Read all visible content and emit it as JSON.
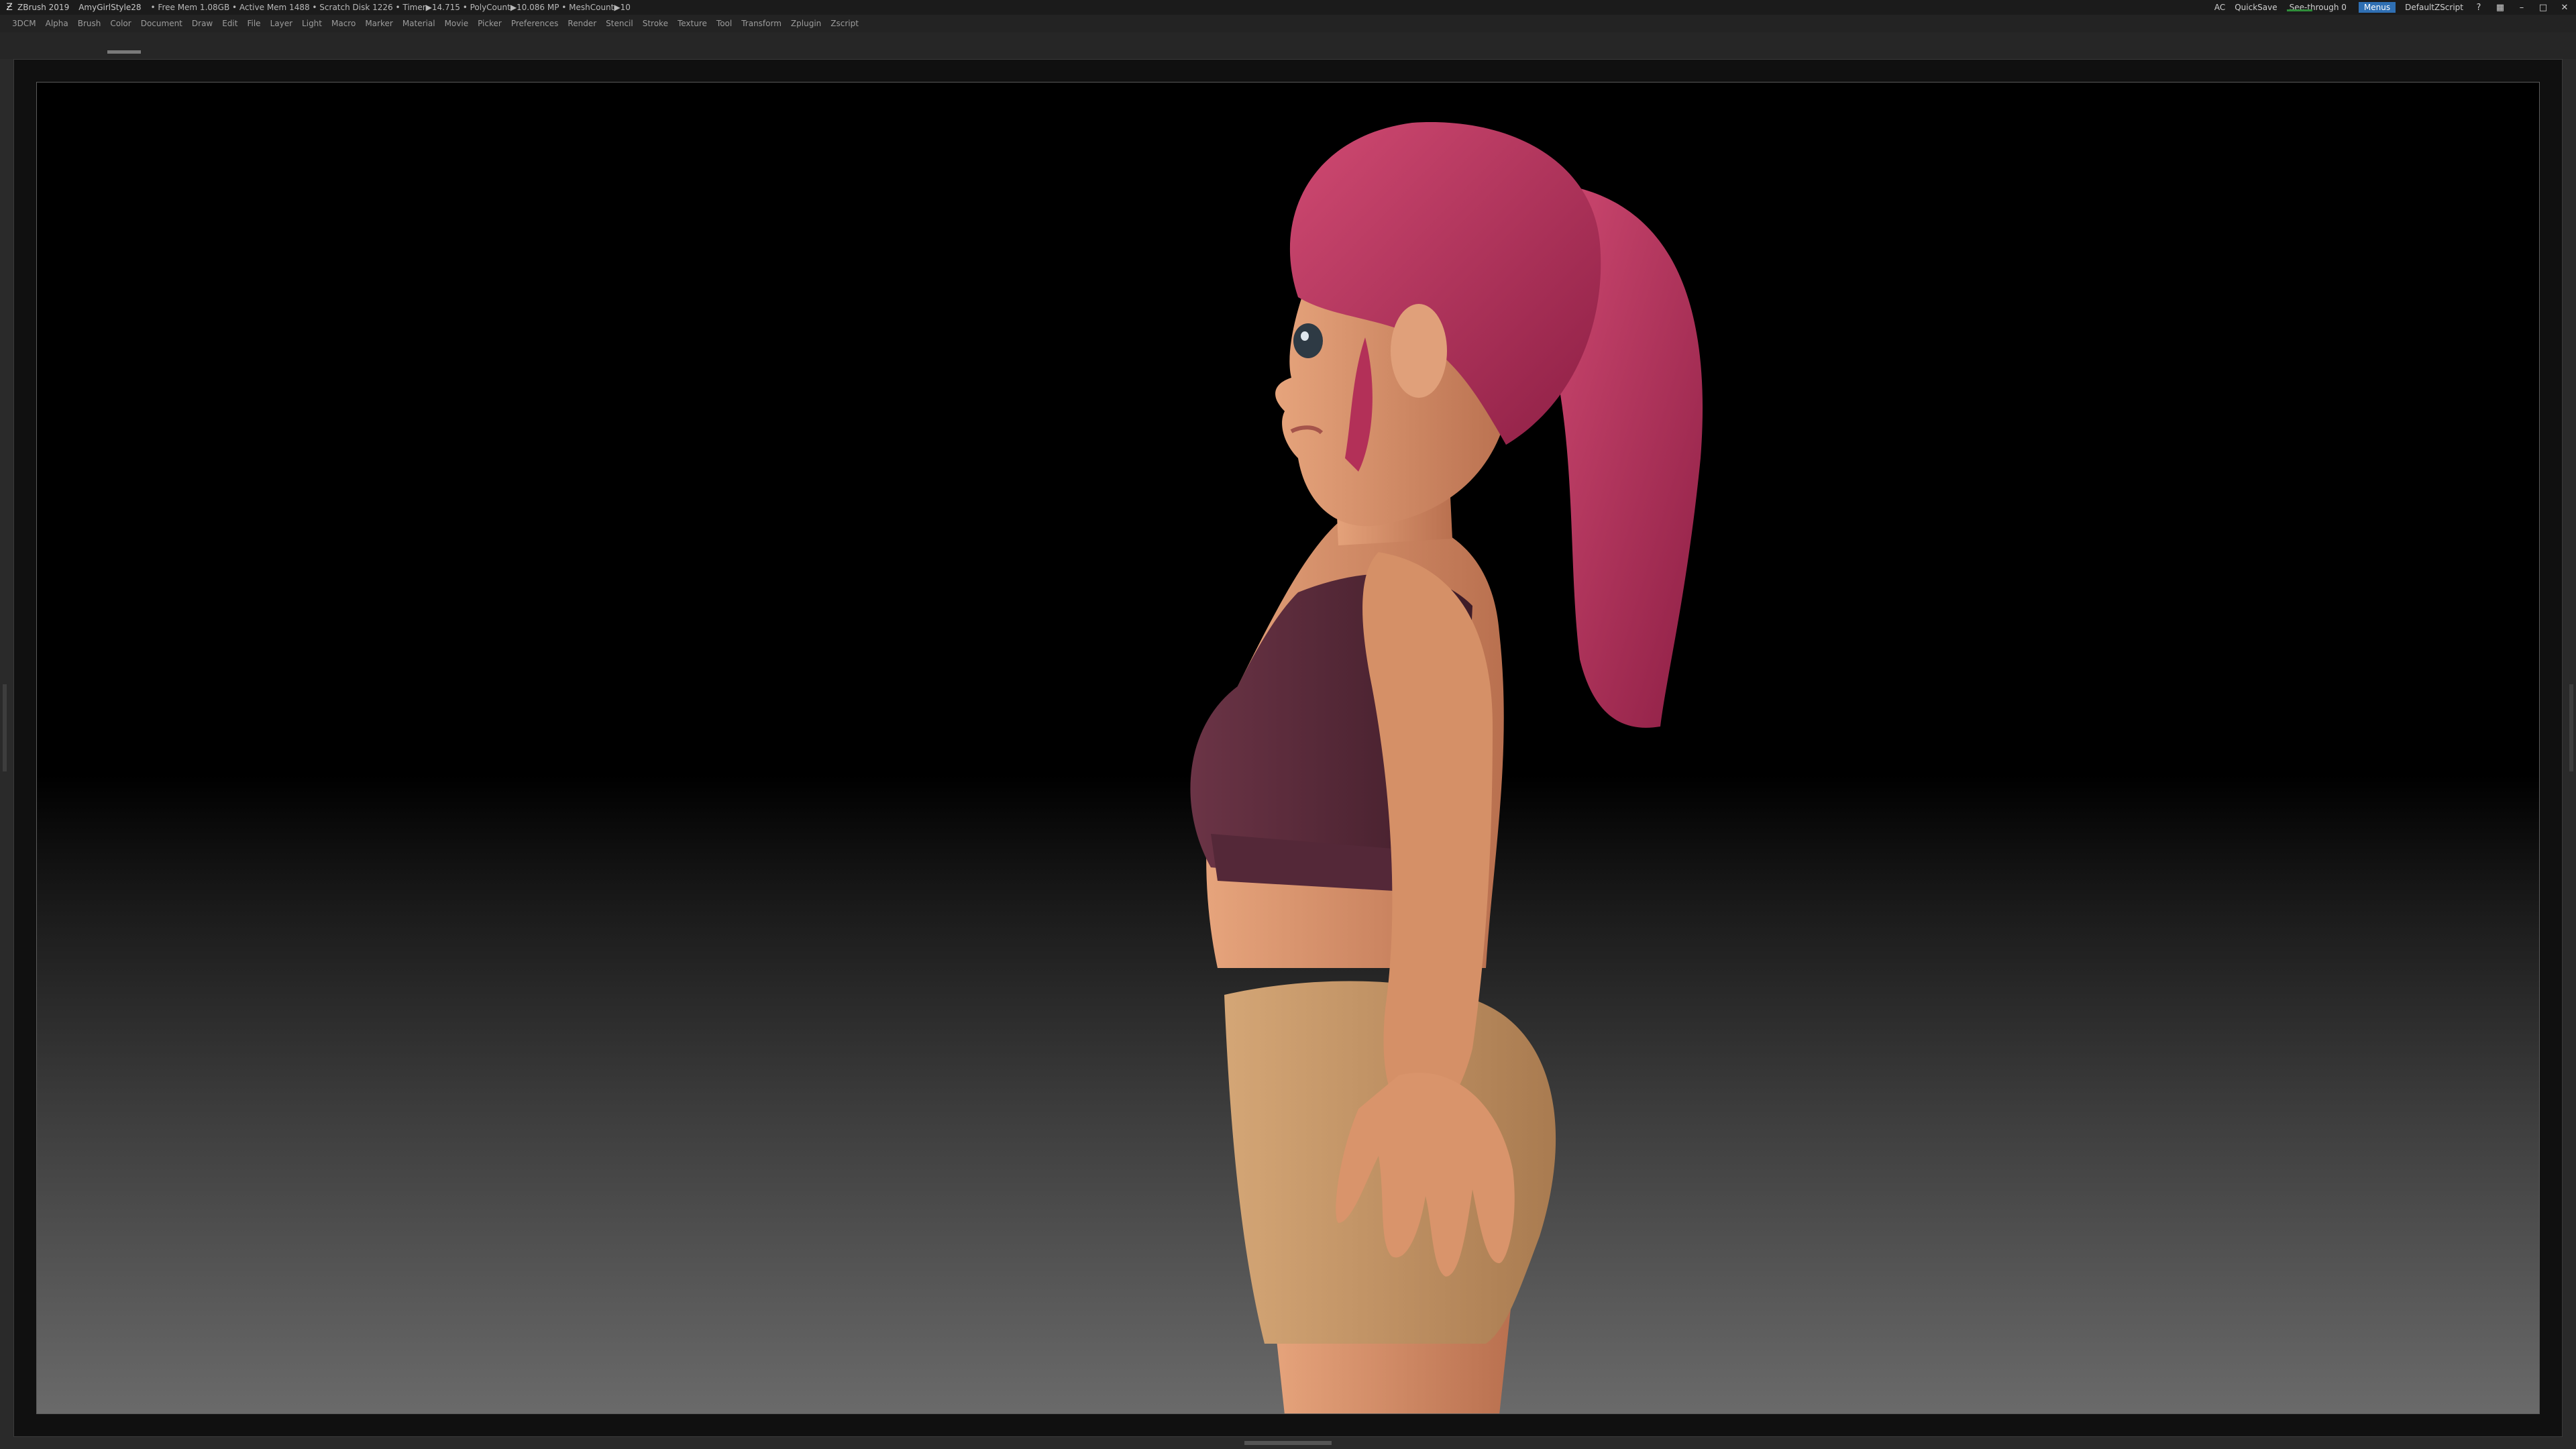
{
  "titlebar": {
    "app": "ZBrush 2019",
    "document": "AmyGirlStyle28",
    "stats": "• Free Mem 1.08GB • Active Mem 1488 • Scratch Disk 1226 • Timer▶14.715 • PolyCount▶10.086 MP • MeshCount▶10",
    "ac": "AC",
    "quicksave": "QuickSave",
    "see_through": "See-through 0",
    "menus": "Menus",
    "default_zscript": "DefaultZScript"
  },
  "menubar": {
    "items": [
      "3DCM",
      "Alpha",
      "Brush",
      "Color",
      "Document",
      "Draw",
      "Edit",
      "File",
      "Layer",
      "Light",
      "Macro",
      "Marker",
      "Material",
      "Movie",
      "Picker",
      "Preferences",
      "Render",
      "Stencil",
      "Stroke",
      "Texture",
      "Tool",
      "Transform",
      "Zplugin",
      "Zscript"
    ]
  },
  "icons": {
    "app_logo": "zbrush-logo-icon",
    "help": "question-icon",
    "layout": "layout-icon",
    "minimize": "minimize-icon",
    "maximize": "maximize-icon",
    "close": "close-icon"
  },
  "colors": {
    "menus_active": "#2f6fb3",
    "see_through_bar": "#2f8d3a",
    "hair": "#b8325a",
    "skin": "#d9906a",
    "top": "#5a2a3a",
    "shorts": "#c79a6a"
  }
}
